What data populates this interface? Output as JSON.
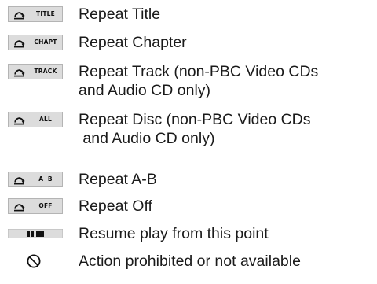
{
  "rows": [
    {
      "icon": "repeat-icon",
      "badge": "TITLE",
      "lines": [
        "Repeat Title"
      ]
    },
    {
      "icon": "repeat-icon",
      "badge": "CHAPT",
      "lines": [
        "Repeat Chapter"
      ]
    },
    {
      "icon": "repeat-icon",
      "badge": "TRACK",
      "lines": [
        "Repeat Track (non-PBC Video CDs",
        "and Audio CD only)"
      ]
    },
    {
      "icon": "repeat-icon",
      "badge": "ALL",
      "lines": [
        "Repeat Disc (non-PBC Video CDs",
        " and Audio CD only)"
      ]
    },
    {
      "icon": "repeat-icon",
      "badge": "A  B",
      "lines": [
        "Repeat A-B"
      ]
    },
    {
      "icon": "repeat-icon",
      "badge": "OFF",
      "lines": [
        "Repeat Off"
      ]
    },
    {
      "icon": "resume-icon",
      "lines": [
        "Resume play from this point"
      ]
    },
    {
      "icon": "prohibited-icon",
      "lines": [
        "Action prohibited or not available"
      ]
    }
  ],
  "colors": {
    "badge_fill": "#dcdcdc",
    "badge_border": "#b4b4b4",
    "text": "#1a1a1a",
    "glyph": "#111111"
  }
}
